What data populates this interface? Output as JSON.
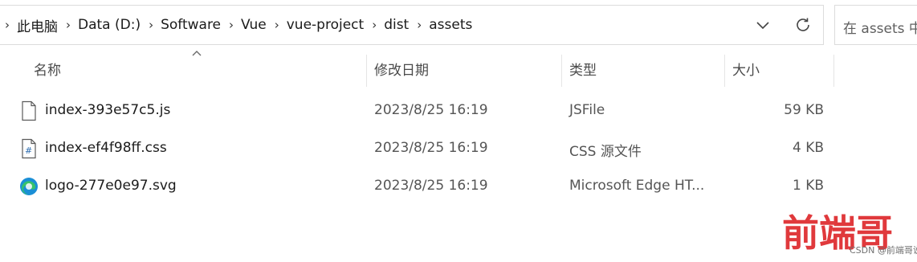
{
  "breadcrumb": {
    "items": [
      "此电脑",
      "Data (D:)",
      "Software",
      "Vue",
      "vue-project",
      "dist",
      "assets"
    ]
  },
  "search": {
    "placeholder": "在 assets 中"
  },
  "columns": {
    "name": "名称",
    "modified": "修改日期",
    "type": "类型",
    "size": "大小"
  },
  "files": [
    {
      "name": "index-393e57c5.js",
      "modified": "2023/8/25 16:19",
      "type": "JSFile",
      "size": "59 KB",
      "icon": "js-file-icon"
    },
    {
      "name": "index-ef4f98ff.css",
      "modified": "2023/8/25 16:19",
      "type": "CSS 源文件",
      "size": "4 KB",
      "icon": "css-file-icon"
    },
    {
      "name": "logo-277e0e97.svg",
      "modified": "2023/8/25 16:19",
      "type": "Microsoft Edge HT...",
      "size": "1 KB",
      "icon": "edge-icon"
    }
  ],
  "watermark": {
    "text": "前端哥",
    "credit": "CSDN @前端哥说"
  },
  "colors": {
    "accent": "#0078d4",
    "watermark": "#e0393c"
  }
}
